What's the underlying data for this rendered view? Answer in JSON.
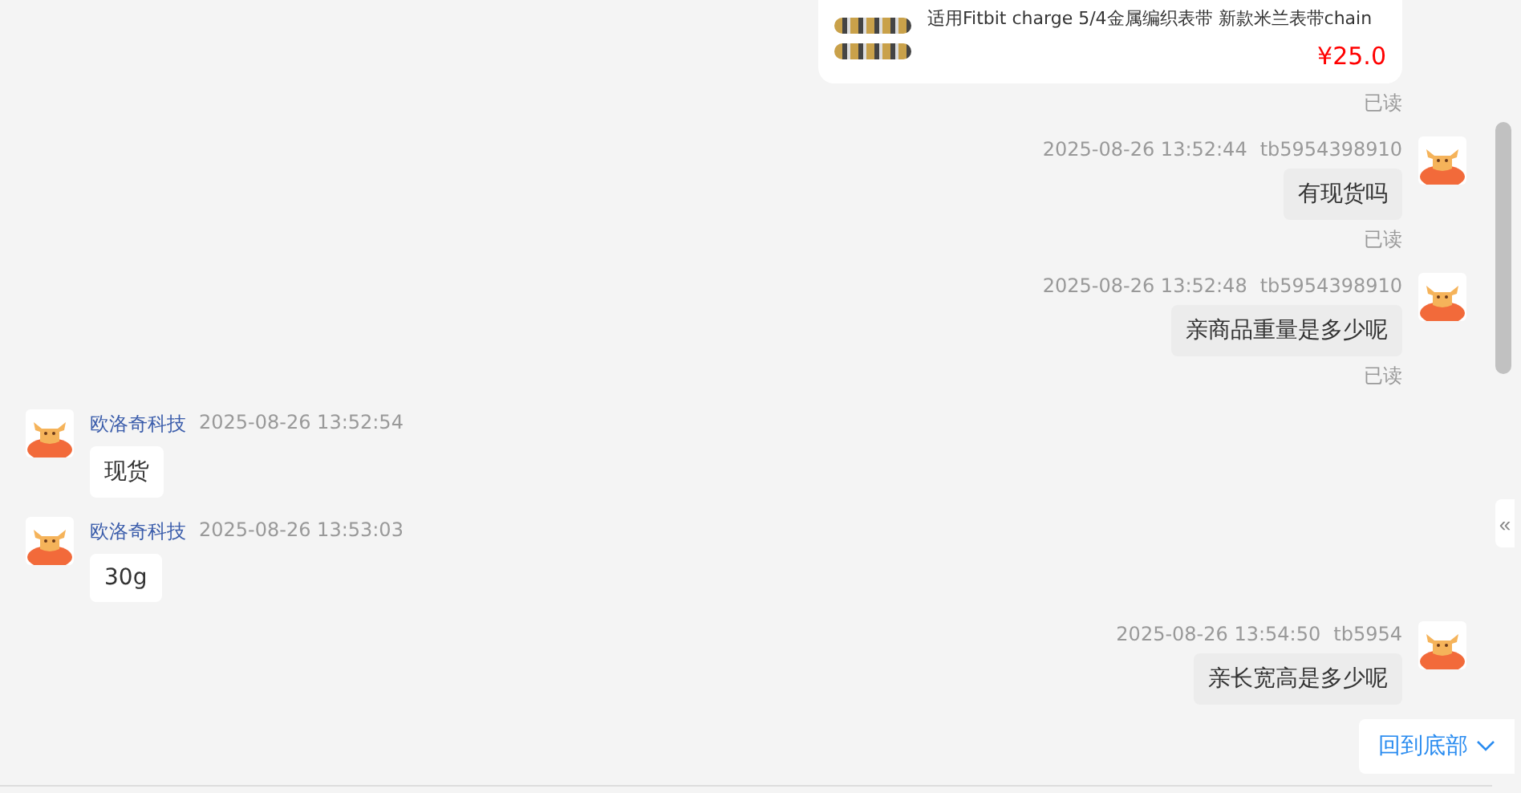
{
  "messages": [
    {
      "kind": "product",
      "from_me": true,
      "title": "适用Fitbit charge 5/4金属编织表带 新款米兰表带chain",
      "price": "¥25.0",
      "read_receipt": "已读"
    },
    {
      "kind": "text",
      "from_me": true,
      "time": "2025-08-26 13:52:44",
      "sender": "tb5954398910",
      "text": "有现货吗",
      "read_receipt": "已读"
    },
    {
      "kind": "text",
      "from_me": true,
      "time": "2025-08-26 13:52:48",
      "sender": "tb5954398910",
      "text": "亲商品重量是多少呢",
      "read_receipt": "已读"
    },
    {
      "kind": "text",
      "from_me": false,
      "sender": "欧洛奇科技",
      "time": "2025-08-26 13:52:54",
      "text": "现货"
    },
    {
      "kind": "text",
      "from_me": false,
      "sender": "欧洛奇科技",
      "time": "2025-08-26 13:53:03",
      "text": "30g"
    },
    {
      "kind": "text",
      "from_me": true,
      "time": "2025-08-26 13:54:50",
      "sender": "tb5954",
      "text": "亲长宽高是多少呢"
    }
  ],
  "collapse_button": {
    "label": "«"
  },
  "scroll_to_bottom": {
    "label": "回到底部"
  }
}
